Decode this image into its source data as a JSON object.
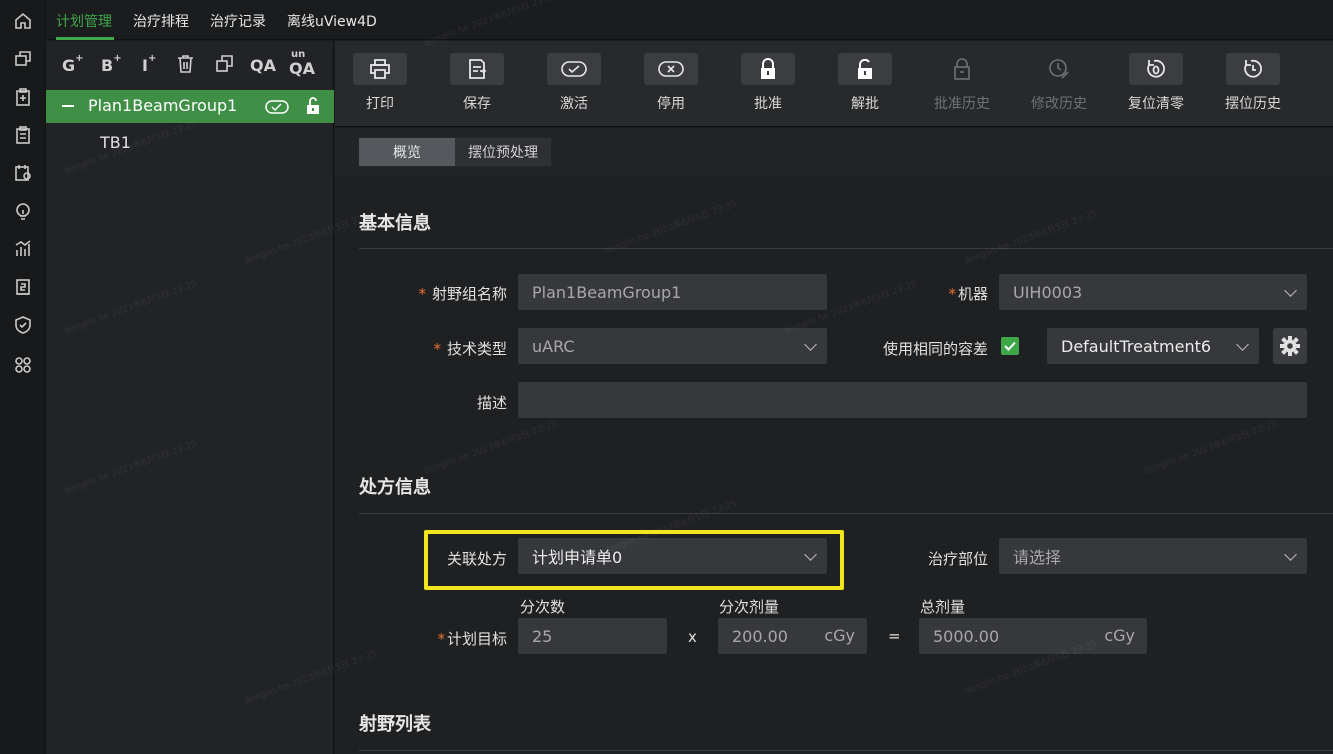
{
  "top_tabs": [
    "计划管理",
    "治疗排程",
    "治疗记录",
    "离线uView4D"
  ],
  "rail_icons": [
    "home-icon",
    "windows-icon",
    "clipboard-plus-icon",
    "clipboard-list-icon",
    "calendar-user-icon",
    "bulb-icon",
    "bar-chart-icon",
    "document-2-icon",
    "shield-check-icon",
    "command-icon"
  ],
  "tree_tools": {
    "g": "G",
    "b": "B",
    "i": "I",
    "qa": "QA",
    "unqa": "QA",
    "unqa_sup": "un",
    "plus": "+"
  },
  "tree": {
    "group_label": "Plan1BeamGroup1",
    "child_label": "TB1"
  },
  "toolbar": {
    "print": "打印",
    "save": "保存",
    "activate": "激活",
    "deactivate": "停用",
    "approve": "批准",
    "unapprove": "解批",
    "approve_history": "批准历史",
    "modify_history": "修改历史",
    "reset_zero": "复位清零",
    "setup_history": "摆位历史"
  },
  "subtabs": {
    "overview": "概览",
    "setup_preprocess": "摆位预处理"
  },
  "basic_info": {
    "title": "基本信息",
    "group_name_label": "射野组名称",
    "group_name_value": "Plan1BeamGroup1",
    "machine_label": "机器",
    "machine_value": "UIH0003",
    "technique_label": "技术类型",
    "technique_value": "uARC",
    "same_tolerance_label": "使用相同的容差",
    "tolerance_value": "DefaultTreatment6",
    "description_label": "描述",
    "description_value": "",
    "required_mark": "*"
  },
  "prescription": {
    "title": "处方信息",
    "linked_label": "关联处方",
    "linked_value": "计划申请单0",
    "site_label": "治疗部位",
    "site_placeholder": "请选择",
    "fractions_label": "分次数",
    "fraction_dose_label": "分次剂量",
    "total_dose_label": "总剂量",
    "target_label": "计划目标",
    "fractions_value": "25",
    "fraction_dose_value": "200.00",
    "total_dose_value": "5000.00",
    "unit": "cGy",
    "times": "x",
    "equals": "="
  },
  "beam_list": {
    "title": "射野列表"
  },
  "watermark_text": "donglin.he 2023年6月5日 23:25",
  "colors": {
    "accent": "#3ea74a",
    "highlight": "#f2e51b",
    "required": "#e8732e"
  }
}
